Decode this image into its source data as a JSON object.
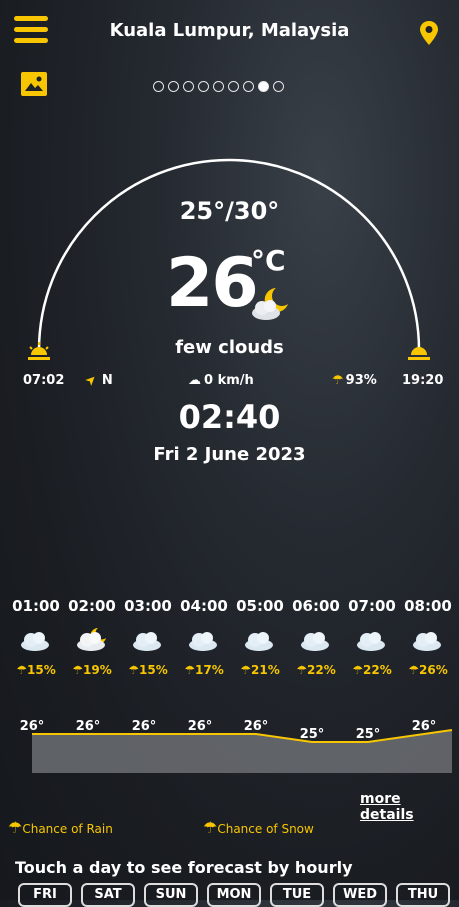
{
  "header": {
    "location": "Kuala Lumpur, Malaysia"
  },
  "pager": {
    "count": 9,
    "active_index": 7
  },
  "current": {
    "range": "25°/30°",
    "temp": "26",
    "unit": "°C",
    "condition": "few clouds",
    "condition_icon": "cloud-moon-icon",
    "sunrise": "07:02",
    "sunset": "19:20",
    "wind_dir": "N",
    "wind_speed": "0 km/h",
    "humidity": "93%",
    "time": "02:40",
    "date": "Fri 2 June 2023"
  },
  "hourly": [
    {
      "time": "01:00",
      "icon": "cloud-icon",
      "precip": "15%",
      "temp": "26°"
    },
    {
      "time": "02:00",
      "icon": "cloud-moon-icon",
      "precip": "19%",
      "temp": "26°"
    },
    {
      "time": "03:00",
      "icon": "cloud-icon",
      "precip": "15%",
      "temp": "26°"
    },
    {
      "time": "04:00",
      "icon": "cloud-icon",
      "precip": "17%",
      "temp": "26°"
    },
    {
      "time": "05:00",
      "icon": "cloud-icon",
      "precip": "21%",
      "temp": "26°"
    },
    {
      "time": "06:00",
      "icon": "cloud-icon",
      "precip": "22%",
      "temp": "25°"
    },
    {
      "time": "07:00",
      "icon": "cloud-icon",
      "precip": "22%",
      "temp": "25°"
    },
    {
      "time": "08:00",
      "icon": "cloud-icon",
      "precip": "26%",
      "temp": "26°"
    }
  ],
  "more_details": "more details",
  "legend": {
    "rain": "Chance of Rain",
    "snow": "Chance of Snow"
  },
  "daily_prompt": "Touch a day to see forecast by hourly",
  "days": [
    "FRI",
    "SAT",
    "SUN",
    "MON",
    "TUE",
    "WED",
    "THU"
  ],
  "colors": {
    "accent": "#f7c600"
  }
}
